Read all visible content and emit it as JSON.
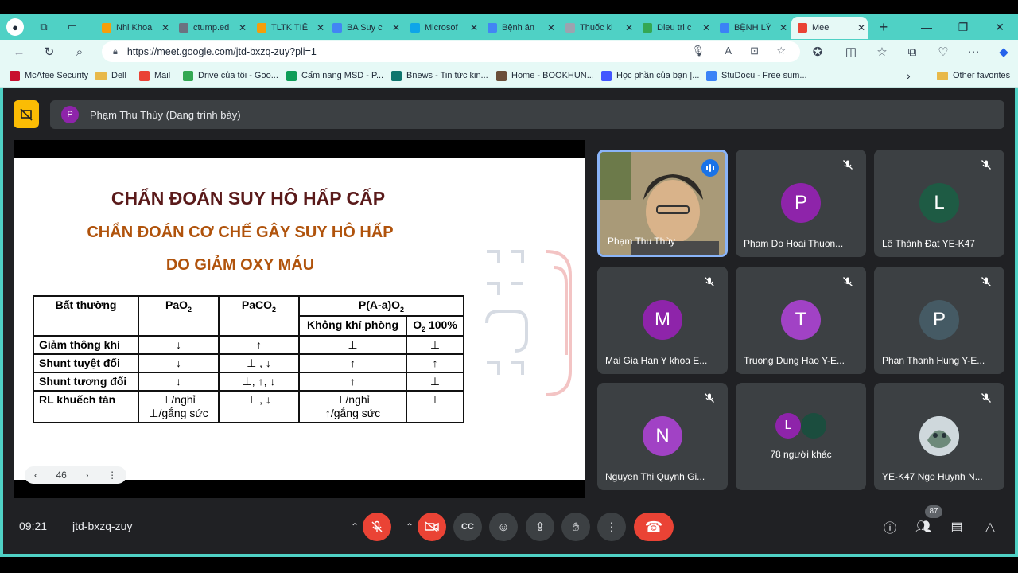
{
  "browser": {
    "tabs": [
      {
        "label": "Nhi Khoa",
        "color": "#f59e0b"
      },
      {
        "label": "ctump.ed",
        "color": "#6b7280"
      },
      {
        "label": "TLTK TIẾ",
        "color": "#f59e0b"
      },
      {
        "label": "BA Suy c",
        "color": "#4285f4"
      },
      {
        "label": "Microsof",
        "color": "#0ea5e9"
      },
      {
        "label": "Bệnh án",
        "color": "#4285f4"
      },
      {
        "label": "Thuốc ki",
        "color": "#9ca3af"
      },
      {
        "label": "Dieu tri c",
        "color": "#34a853"
      },
      {
        "label": "BỆNH LÝ",
        "color": "#3b82f6"
      },
      {
        "label": "Mee",
        "color": "#ea4335"
      }
    ],
    "url": "https://meet.google.com/jtd-bxzq-zuy?pli=1",
    "bookmarks": [
      {
        "label": "McAfee Security",
        "icon": "mcafee-icon",
        "color": "#c8102e"
      },
      {
        "label": "Dell",
        "icon": "folder-icon",
        "color": "#e8b949"
      },
      {
        "label": "Mail",
        "icon": "gmail-icon",
        "color": "#ea4335"
      },
      {
        "label": "Drive của tôi - Goo...",
        "icon": "drive-icon",
        "color": "#34a853"
      },
      {
        "label": "Cẩm nang MSD - P...",
        "icon": "msd-icon",
        "color": "#0f9d58"
      },
      {
        "label": "Bnews - Tin tức kin...",
        "icon": "bnews-icon",
        "color": "#0f766e"
      },
      {
        "label": "Home - BOOKHUN...",
        "icon": "bookhunter-icon",
        "color": "#6b4f3a"
      },
      {
        "label": "Học phần của bạn |...",
        "icon": "quizlet-icon",
        "color": "#4255ff"
      },
      {
        "label": "StuDocu - Free sum...",
        "icon": "studocu-icon",
        "color": "#3b82f6"
      }
    ],
    "other_favorites": "Other favorites"
  },
  "meet": {
    "presenter_initial": "P",
    "presenter_text": "Phạm Thu Thùy (Đang trình bày)",
    "slide": {
      "title1": "CHẨN ĐOÁN SUY HÔ HẤP CẤP",
      "title2": "CHẨN ĐOÁN CƠ CHẾ GÂY SUY HÔ HẤP",
      "title3": "DO GIẢM OXY MÁU",
      "table": {
        "h_abnormal": "Bất thường",
        "h_pao2": "PaO",
        "h_pao2_sub": "2",
        "h_paco2": "PaCO",
        "h_paco2_sub": "2",
        "h_aa": "P(A-a)O",
        "h_aa_sub": "2",
        "h_room_air": "Không khí phòng",
        "h_o2": "O",
        "h_o2_sub": "2",
        "h_o2_rest": " 100%",
        "rows": [
          {
            "label": "Giảm thông khí",
            "pao2": "↓",
            "paco2": "↑",
            "room": "⊥",
            "o2": "⊥"
          },
          {
            "label": "Shunt tuyệt đối",
            "pao2": "↓",
            "paco2": "⊥ , ↓",
            "room": "↑",
            "o2": "↑"
          },
          {
            "label": "Shunt tương đối",
            "pao2": "↓",
            "paco2": "⊥, ↑, ↓",
            "room": "↑",
            "o2": "⊥"
          },
          {
            "label": "RL khuếch tán",
            "pao2": "⊥/nghỉ\n⊥/gắng sức",
            "paco2": "⊥ , ↓",
            "room": "⊥/nghỉ\n↑/gắng sức",
            "o2": "⊥"
          }
        ]
      },
      "page_number": "46"
    },
    "participants": [
      {
        "name": "Phạm Thu Thùy",
        "initial": "",
        "color": "",
        "speaking": true
      },
      {
        "name": "Pham Do Hoai Thuon...",
        "initial": "P",
        "color": "#8e24aa"
      },
      {
        "name": "Lê Thành Đạt YE-K47",
        "initial": "L",
        "color": "#1e5b44"
      },
      {
        "name": "Mai Gia Han Y khoa E...",
        "initial": "M",
        "color": "#8e24aa"
      },
      {
        "name": "Truong Dung Hao Y-E...",
        "initial": "T",
        "color": "#a142c5"
      },
      {
        "name": "Phan Thanh Hung Y-E...",
        "initial": "P",
        "color": "#455a64"
      },
      {
        "name": "Nguyen Thi Quynh Gi...",
        "initial": "N",
        "color": "#a142c5"
      },
      {
        "name": "78 người khác",
        "initial": "L",
        "color": "#8e24aa",
        "others": true
      },
      {
        "name": "YE-K47 Ngo Huynh N...",
        "initial": "",
        "color": "#b0bec5"
      }
    ],
    "time": "09:21",
    "code": "jtd-bxzq-zuy",
    "people_count": "87"
  }
}
